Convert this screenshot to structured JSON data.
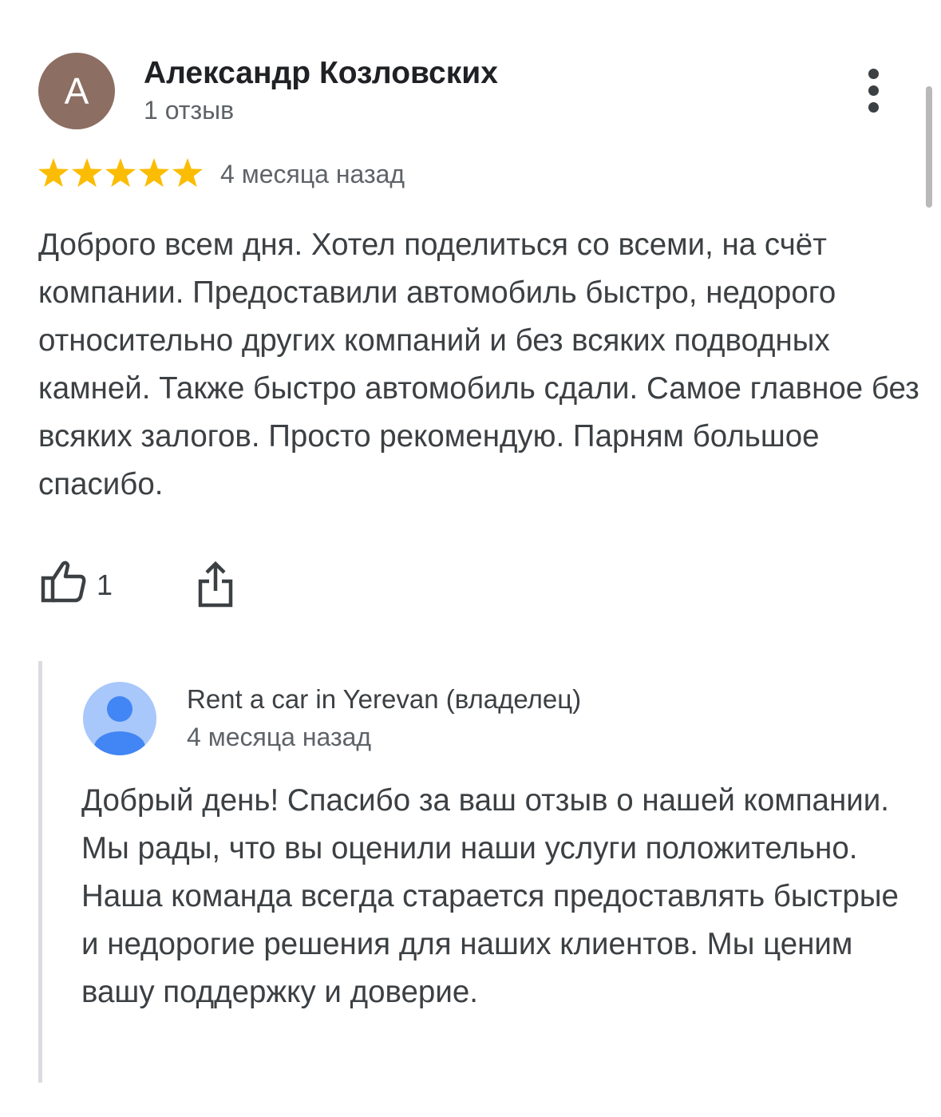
{
  "review": {
    "avatar_letter": "A",
    "avatar_color": "#8d6e63",
    "reviewer_name": "Александр Козловских",
    "review_count": "1 отзыв",
    "rating": 5,
    "rating_max": 5,
    "star_color": "#fbbc04",
    "date": "4 месяца назад",
    "text": "Доброго всем дня. Хотел поделиться со всеми, на счёт компании. Предоставили автомобиль быстро, недорого относительно других компаний и без всяких подводных камней. Также быстро автомобиль сдали. Самое главное без всяких залогов. Просто рекомендую. Парням большое спасибо.",
    "likes": "1",
    "icons": {
      "more": "more-vert-icon",
      "like": "thumb-up-icon",
      "share": "share-icon"
    }
  },
  "owner_reply": {
    "name": "Rent a car in Yerevan (владелец)",
    "avatar_icon": "person-icon",
    "avatar_color": "#4285f4",
    "date": "4 месяца назад",
    "text": "Добрый день! Спасибо за ваш отзыв о нашей компании. Мы рады, что вы оценили наши услуги положительно. Наша команда всегда старается предоставлять быстрые и недорогие решения для наших клиентов. Мы ценим вашу поддержку и доверие."
  }
}
